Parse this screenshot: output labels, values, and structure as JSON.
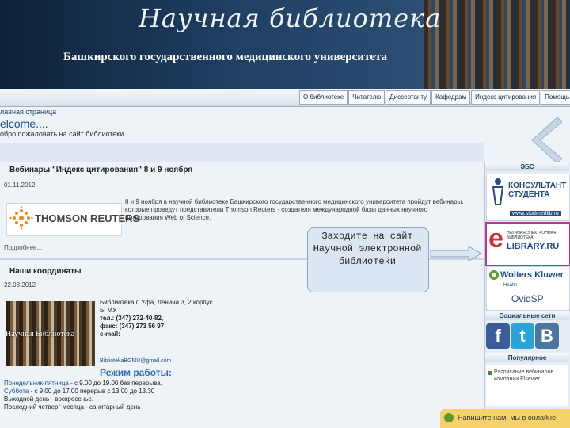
{
  "header": {
    "title": "Научная библиотека",
    "subtitle": "Башкирского государственного медицинского университета"
  },
  "nav": {
    "items": [
      "О библиотеке",
      "Читателю",
      "Диссертанту",
      "Кафедрам",
      "Индекс цитирования",
      "Помощь"
    ]
  },
  "breadcrumb": "лавная страница",
  "welcome": {
    "title": "elcome....",
    "subtitle": "обро пожаловать на сайт библиотеки"
  },
  "webinar": {
    "title": "Вебинары \"Индекс цитирования\" 8 и 9 ноября",
    "date": "01.11.2012",
    "logo_text": "THOMSON REUTERS",
    "text": "8 и 9 ноября в научной библиотеке Башкирского государственного медицинского университета пройдут вебинары, которые проведут представители Thomson Reuters - создателя международной базы данных научного цитирования Web of Science.",
    "more": "Подробнее..."
  },
  "contacts": {
    "title": "Наши координаты",
    "date": "22.03.2012",
    "image_label": "Научная Библиотека",
    "address": "Библиотека г. Уфа, Ленина 3, 2 корпус БГМУ",
    "phone": "тел.: (347) 272-40-82,",
    "fax": "факс: (347) 273 56 97",
    "email_label": "e-mail:",
    "email": "BibliotekaBGMU@gmail.com",
    "hours_title": "Режим работы:",
    "hours": [
      {
        "day": "Понедельник-пятница",
        "time": " - с 9.00 до 19.00 без перерыва,"
      },
      {
        "day": "Суббота",
        "time": " - с 9.00 до 17.00 перерыв с 13.00 до 13.30"
      },
      {
        "day": "",
        "time": "Выходной день - воскресенье."
      },
      {
        "day": "",
        "time": "Последний четверг месяца - санитарный день"
      }
    ]
  },
  "callout": {
    "text": "Заходите на сайт Научной электронной библиотеки"
  },
  "sidebar": {
    "ebs_title": "ЭБС",
    "consult_line1": "КОНСУЛЬТАНТ",
    "consult_line2": "СТУДЕНТА",
    "consult_url": "www.studmedlib.ru",
    "elib_small": "НАУЧНАЯ ЭЛЕКТРОННАЯ БИБЛИОТЕКА",
    "elib_name": "LIBRARY.RU",
    "wk_name": "Wolters Kluwer",
    "wk_health": "Health",
    "ovid": "OvidSP",
    "social_title": "Социальные сети",
    "popular_title": "Популярное",
    "popular_item": "Расписание вебинаров компании Elsevier"
  },
  "bottom_bar": {
    "text": "Напишите нам, мы в онлайне!"
  },
  "colors": {
    "header_bg": "#1c3550",
    "accent": "#2e6fb3",
    "elib_border": "#c2338a"
  }
}
